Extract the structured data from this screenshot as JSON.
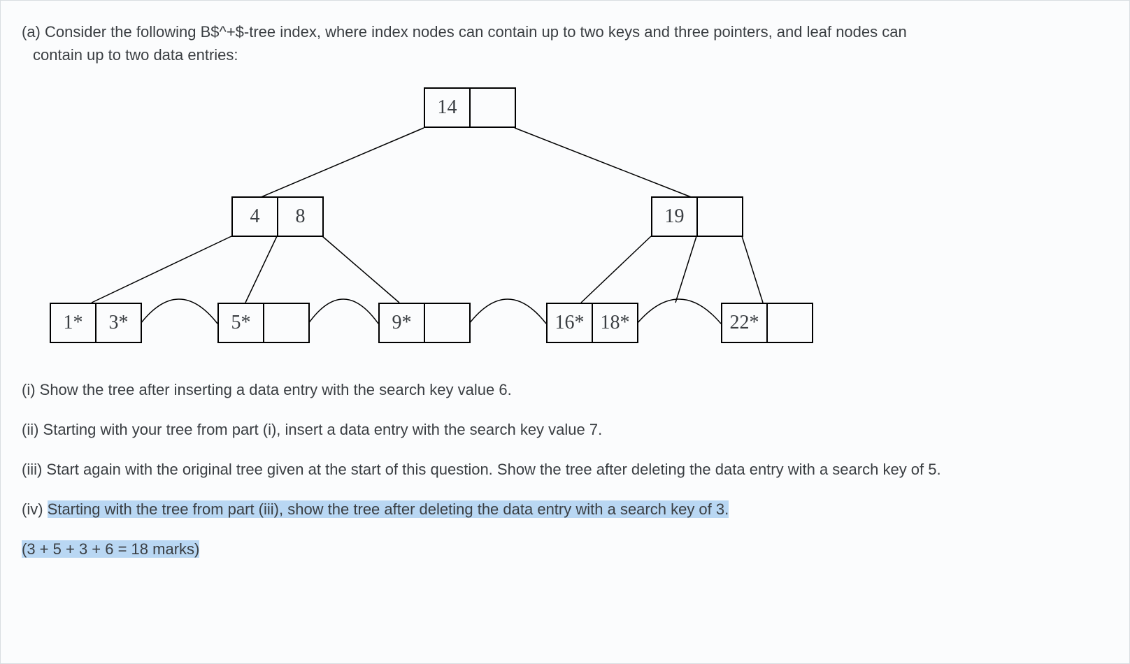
{
  "question": {
    "part_label": "(a)",
    "intro_line1": "Consider the following B$^+$-tree index, where index nodes can contain up to two keys and three pointers, and leaf nodes can",
    "intro_line2": "contain up to two data entries:"
  },
  "tree": {
    "root": {
      "cells": [
        "14",
        ""
      ]
    },
    "inner": [
      {
        "cells": [
          "4",
          "8"
        ]
      },
      {
        "cells": [
          "19",
          ""
        ]
      }
    ],
    "leaves": [
      {
        "cells": [
          "1*",
          "3*"
        ]
      },
      {
        "cells": [
          "5*",
          ""
        ]
      },
      {
        "cells": [
          "9*",
          ""
        ]
      },
      {
        "cells": [
          "16*",
          "18*"
        ]
      },
      {
        "cells": [
          "22*",
          ""
        ]
      }
    ]
  },
  "subparts": {
    "i": "(i) Show the tree after inserting a data entry with the search key value 6.",
    "ii": "(ii) Starting with your tree from part (i), insert a data entry with the search key value 7.",
    "iii": "(iii) Start again with the original tree given at the start of this question. Show the tree after deleting the data entry with a search key of 5.",
    "iv_prefix": "(iv) ",
    "iv_highlight": "Starting with the tree from part (iii), show the tree after deleting the data entry with a search key of 3."
  },
  "marks_line": "(3 + 5 + 3 + 6 = 18 marks)"
}
